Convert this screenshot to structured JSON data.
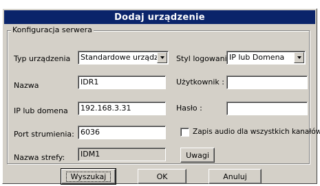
{
  "window": {
    "title": "Dodaj urządzenie"
  },
  "group": {
    "title": "Konfiguracja serwera"
  },
  "fields": {
    "device_type": {
      "label": "Typ urządzenia",
      "value": "Standardowe urządzer"
    },
    "login_style": {
      "label": "Styl logowania",
      "value": "IP lub Domena"
    },
    "name": {
      "label": "Nazwa",
      "value": "IDR1"
    },
    "user": {
      "label": "Użytkownik :",
      "value": ""
    },
    "ip": {
      "label": "IP lub domena",
      "value": "192.168.3.31"
    },
    "password": {
      "label": "Hasło :",
      "value": ""
    },
    "port": {
      "label": "Port strumienia:",
      "value": "6036"
    },
    "audio": {
      "label": "Zapis audio dla wszystkich kanałów",
      "checked": false
    },
    "zone": {
      "label": "Nazwa strefy:",
      "value": "IDM1"
    }
  },
  "buttons": {
    "notes": "Uwagi",
    "search": "Wyszukaj",
    "ok": "OK",
    "cancel": "Anuluj"
  }
}
